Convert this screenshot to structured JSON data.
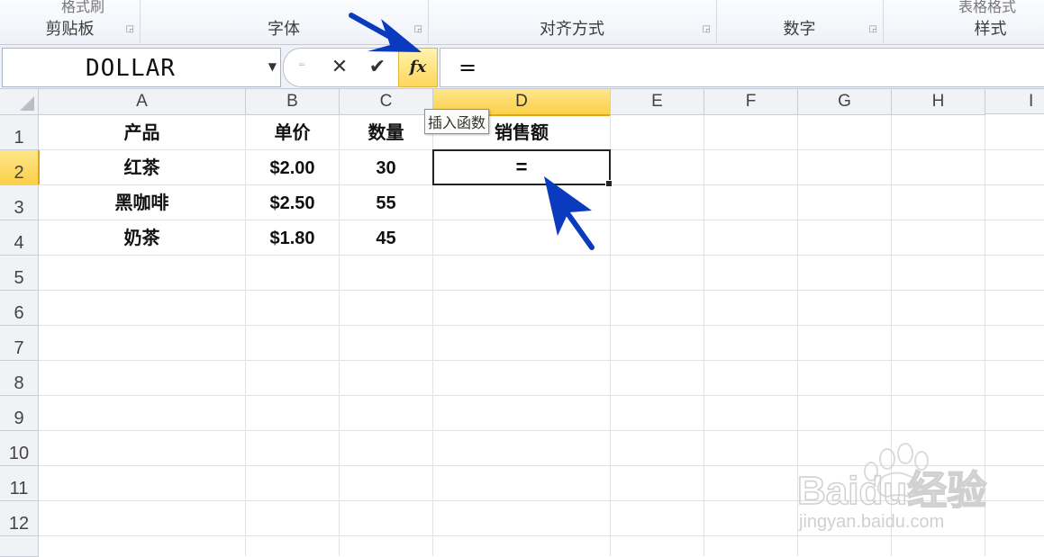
{
  "ribbon": {
    "groups": [
      {
        "label": "剪贴板",
        "top_text": "格式刷"
      },
      {
        "label": "字体"
      },
      {
        "label": "对齐方式"
      },
      {
        "label": "数字"
      },
      {
        "label": "样式",
        "top_text": "表格格式"
      }
    ]
  },
  "formula_bar": {
    "name_box": "DOLLAR",
    "fx_label": "fx",
    "formula": "=",
    "tooltip": "插入函数"
  },
  "columns": [
    "A",
    "B",
    "C",
    "D",
    "E",
    "F",
    "G",
    "H",
    "I"
  ],
  "rows": [
    "1",
    "2",
    "3",
    "4",
    "5",
    "6",
    "7",
    "8",
    "9",
    "10",
    "11",
    "12"
  ],
  "table": {
    "headers": [
      "产品",
      "单价",
      "数量",
      "销售额"
    ],
    "data": [
      [
        "红茶",
        "$2.00",
        "30"
      ],
      [
        "黑咖啡",
        "$2.50",
        "55"
      ],
      [
        "奶茶",
        "$1.80",
        "45"
      ]
    ]
  },
  "active_cell": {
    "ref": "D2",
    "value": "="
  },
  "watermark": {
    "text": "Baidu经验",
    "url": "jingyan.baidu.com"
  },
  "colors": {
    "accent": "#ffd75a",
    "arrow": "#0a3bbf"
  }
}
